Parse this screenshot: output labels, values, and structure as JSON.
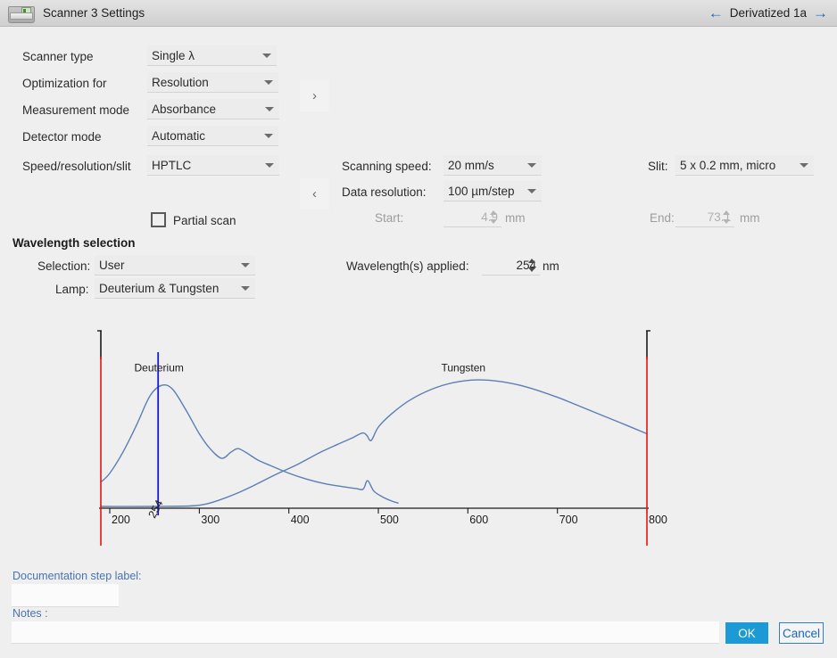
{
  "window": {
    "title": "Scanner 3 Settings",
    "icon": "scanner-icon",
    "nav": {
      "prev_icon": "arrow-left-icon",
      "next_icon": "arrow-right-icon",
      "track_label": "Derivatized 1a"
    }
  },
  "left_form": {
    "rows": [
      {
        "label": "Scanner type",
        "value": "Single λ"
      },
      {
        "label": "Optimization for",
        "value": "Resolution"
      },
      {
        "label": "Measurement mode",
        "value": "Absorbance"
      },
      {
        "label": "Detector mode",
        "value": "Automatic"
      },
      {
        "label": "Speed/resolution/slit",
        "value": "HPTLC"
      }
    ],
    "partial_scan": {
      "label": "Partial scan",
      "checked": false
    }
  },
  "pager": {
    "next_label": "›",
    "prev_label": "‹"
  },
  "scan_params": {
    "scanning_speed": {
      "label": "Scanning speed:",
      "value": "20 mm/s"
    },
    "data_resolution": {
      "label": "Data resolution:",
      "value": "100 µm/step"
    },
    "start": {
      "label": "Start:",
      "value": "4.9",
      "unit": "mm",
      "disabled": true
    },
    "slit": {
      "label": "Slit:",
      "value": "5 x 0.2 mm, micro"
    },
    "end": {
      "label": "End:",
      "value": "73.1",
      "unit": "mm",
      "disabled": true
    }
  },
  "wavelength": {
    "section_title": "Wavelength selection",
    "selection": {
      "label": "Selection:",
      "value": "User"
    },
    "lamp": {
      "label": "Lamp:",
      "value": "Deuterium & Tungsten"
    },
    "applied": {
      "label": "Wavelength(s) applied:",
      "value": "254",
      "unit": "nm"
    }
  },
  "chart_data": {
    "type": "line",
    "title": "",
    "xlabel": "",
    "ylabel": "",
    "xlim": [
      190,
      800
    ],
    "ylim": [
      0,
      1
    ],
    "grid": false,
    "legend": "inline-annotations",
    "tick_labels": [
      "200",
      "300",
      "400",
      "500",
      "600",
      "700",
      "800"
    ],
    "ticks": [
      200,
      300,
      400,
      500,
      600,
      700,
      800
    ],
    "annotations": [
      {
        "text": "Deuterium",
        "x": 255,
        "y": 0.92
      },
      {
        "text": "Tungsten",
        "x": 595,
        "y": 0.92
      }
    ],
    "markers": [
      {
        "name": "selected-wavelength",
        "value": 254,
        "label": "254",
        "color": "#1a1ad0",
        "orientation": "vertical"
      },
      {
        "name": "range-start",
        "value": 190,
        "color": "#e81313",
        "orientation": "vertical"
      },
      {
        "name": "range-end",
        "value": 800,
        "color": "#e81313",
        "orientation": "vertical"
      }
    ],
    "series": [
      {
        "name": "Deuterium",
        "color": "#5b7fb4",
        "x": [
          190,
          200,
          215,
          230,
          245,
          258,
          270,
          285,
          300,
          312,
          325,
          335,
          343,
          352,
          365,
          380,
          400,
          420,
          440,
          460,
          475,
          483,
          488,
          495,
          505,
          515,
          522
        ],
        "y": [
          0.175,
          0.235,
          0.38,
          0.56,
          0.755,
          0.825,
          0.8,
          0.66,
          0.5,
          0.4,
          0.335,
          0.375,
          0.4,
          0.375,
          0.325,
          0.285,
          0.235,
          0.195,
          0.165,
          0.145,
          0.132,
          0.128,
          0.185,
          0.115,
          0.075,
          0.048,
          0.035
        ]
      },
      {
        "name": "Tungsten",
        "color": "#5b7fb4",
        "x": [
          190,
          250,
          290,
          305,
          320,
          340,
          360,
          385,
          410,
          435,
          455,
          470,
          482,
          487,
          492,
          500,
          515,
          535,
          560,
          585,
          610,
          635,
          665,
          700,
          735,
          770,
          800
        ],
        "y": [
          0.012,
          0.012,
          0.015,
          0.025,
          0.05,
          0.095,
          0.15,
          0.225,
          0.295,
          0.375,
          0.43,
          0.47,
          0.505,
          0.49,
          0.455,
          0.545,
          0.635,
          0.725,
          0.8,
          0.845,
          0.862,
          0.852,
          0.815,
          0.745,
          0.66,
          0.575,
          0.5
        ]
      }
    ]
  },
  "footer": {
    "doc_label": {
      "label": "Documentation step label:",
      "value": "",
      "placeholder": ""
    },
    "notes": {
      "label": "Notes :",
      "value": "",
      "placeholder": ""
    },
    "ok_label": "OK",
    "cancel_label": "Cancel"
  }
}
